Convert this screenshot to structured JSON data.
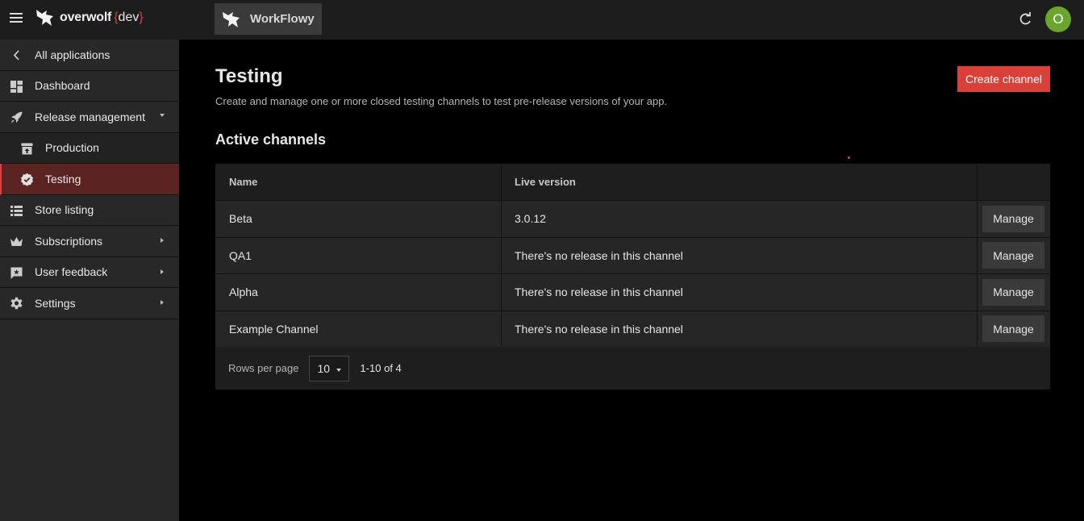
{
  "header": {
    "logo_text": "overwolf",
    "logo_dev_open": "{",
    "logo_dev": "dev",
    "logo_dev_close": "}",
    "app_name": "WorkFlowy",
    "avatar_initial": "O"
  },
  "sidebar": {
    "items": [
      {
        "label": "All applications",
        "icon": "chevron-left-icon"
      },
      {
        "label": "Dashboard",
        "icon": "dashboard-icon"
      },
      {
        "label": "Release management",
        "icon": "rocket-icon"
      },
      {
        "label": "Production",
        "icon": "archive-upload-icon"
      },
      {
        "label": "Testing",
        "icon": "check-badge-icon"
      },
      {
        "label": "Store listing",
        "icon": "list-icon"
      },
      {
        "label": "Subscriptions",
        "icon": "crown-icon"
      },
      {
        "label": "User feedback",
        "icon": "feedback-icon"
      },
      {
        "label": "Settings",
        "icon": "gear-icon"
      }
    ]
  },
  "main": {
    "title": "Testing",
    "description": "Create and manage one or more closed testing channels to test pre-release versions of your app.",
    "create_button": "Create channel",
    "section_title": "Active channels",
    "table": {
      "columns": [
        "Name",
        "Live version"
      ],
      "rows": [
        {
          "name": "Beta",
          "version": "3.0.12",
          "action": "Manage"
        },
        {
          "name": "QA1",
          "version": "There's no release in this channel",
          "action": "Manage"
        },
        {
          "name": "Alpha",
          "version": "There's no release in this channel",
          "action": "Manage"
        },
        {
          "name": "Example Channel",
          "version": "There's no release in this channel",
          "action": "Manage"
        }
      ]
    },
    "pagination": {
      "rows_per_page_label": "Rows per page",
      "rows_per_page_value": "10",
      "range": "1-10 of 4"
    }
  },
  "colors": {
    "accent": "#d9403a",
    "sidebar_bg": "#282828",
    "active_item_bg": "#5a2322",
    "avatar_bg": "#6aa52e"
  }
}
